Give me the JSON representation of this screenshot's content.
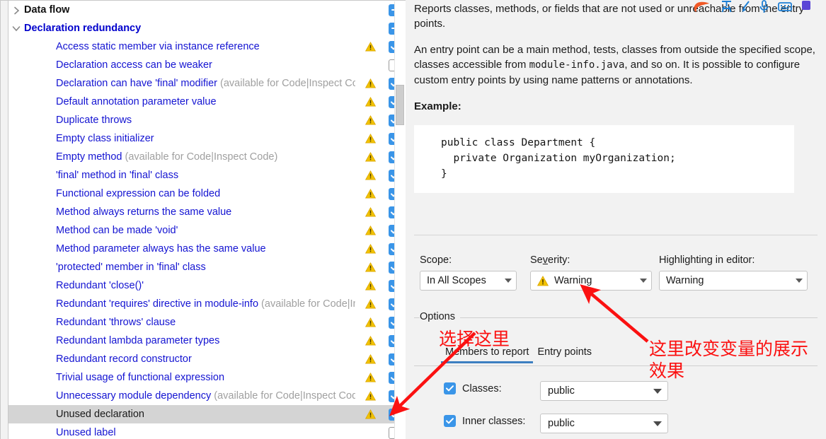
{
  "tree": {
    "items": [
      {
        "label": "Data flow",
        "kind": "group",
        "twisty": "chevron-right-icon",
        "color": "black",
        "check": "partial",
        "warn": false,
        "avail": ""
      },
      {
        "label": "Declaration redundancy",
        "kind": "group",
        "twisty": "chevron-down-icon",
        "color": "blue",
        "check": "partial",
        "warn": false,
        "avail": ""
      },
      {
        "label": "Access static member via instance reference",
        "kind": "leaf",
        "check": "on",
        "warn": true,
        "avail": ""
      },
      {
        "label": "Declaration access can be weaker",
        "kind": "leaf",
        "check": "off",
        "warn": false,
        "avail": ""
      },
      {
        "label": "Declaration can have 'final' modifier",
        "kind": "leaf",
        "check": "on",
        "warn": true,
        "avail": " (available for Code|Inspect Code)"
      },
      {
        "label": "Default annotation parameter value",
        "kind": "leaf",
        "check": "on",
        "warn": true,
        "avail": ""
      },
      {
        "label": "Duplicate throws",
        "kind": "leaf",
        "check": "on",
        "warn": true,
        "avail": ""
      },
      {
        "label": "Empty class initializer",
        "kind": "leaf",
        "check": "on",
        "warn": true,
        "avail": ""
      },
      {
        "label": "Empty method",
        "kind": "leaf",
        "check": "on",
        "warn": true,
        "avail": " (available for Code|Inspect Code)"
      },
      {
        "label": "'final' method in 'final' class",
        "kind": "leaf",
        "check": "on",
        "warn": true,
        "avail": ""
      },
      {
        "label": "Functional expression can be folded",
        "kind": "leaf",
        "check": "on",
        "warn": true,
        "avail": ""
      },
      {
        "label": "Method always returns the same value",
        "kind": "leaf",
        "check": "on",
        "warn": true,
        "avail": ""
      },
      {
        "label": "Method can be made 'void'",
        "kind": "leaf",
        "check": "on",
        "warn": true,
        "avail": ""
      },
      {
        "label": "Method parameter always has the same value",
        "kind": "leaf",
        "check": "on",
        "warn": true,
        "avail": ""
      },
      {
        "label": "'protected' member in 'final' class",
        "kind": "leaf",
        "check": "on",
        "warn": true,
        "avail": ""
      },
      {
        "label": "Redundant 'close()'",
        "kind": "leaf",
        "check": "on",
        "warn": true,
        "avail": ""
      },
      {
        "label": "Redundant 'requires' directive in module-info",
        "kind": "leaf",
        "check": "on",
        "warn": true,
        "avail": " (available for Code|Inspect Code)"
      },
      {
        "label": "Redundant 'throws' clause",
        "kind": "leaf",
        "check": "on",
        "warn": true,
        "avail": ""
      },
      {
        "label": "Redundant lambda parameter types",
        "kind": "leaf",
        "check": "on",
        "warn": true,
        "avail": ""
      },
      {
        "label": "Redundant record constructor",
        "kind": "leaf",
        "check": "on",
        "warn": true,
        "avail": ""
      },
      {
        "label": "Trivial usage of functional expression",
        "kind": "leaf",
        "check": "on",
        "warn": true,
        "avail": ""
      },
      {
        "label": "Unnecessary module dependency",
        "kind": "leaf",
        "check": "on",
        "warn": true,
        "avail": " (available for Code|Inspect Code)"
      },
      {
        "label": "Unused declaration",
        "kind": "leaf",
        "check": "on",
        "warn": true,
        "avail": "",
        "selected": true
      },
      {
        "label": "Unused label",
        "kind": "leaf",
        "check": "off",
        "warn": false,
        "avail": ""
      }
    ]
  },
  "description": {
    "para1": "Reports classes, methods, or fields that are not used or unreachable from the entry points.",
    "para2_a": "An entry point can be a main method, tests, classes from outside the specified scope, classes accessible from ",
    "para2_code": "module-info.java",
    "para2_b": ", and so on. It is possible to configure custom entry points by using name patterns or annotations.",
    "example_label": "Example:",
    "example_code": "public class Department {\n  private Organization myOrganization;\n}"
  },
  "controls": {
    "scope": {
      "caption": "Scope:",
      "value": "In All Scopes"
    },
    "severity": {
      "caption_pre": "Se",
      "caption_mnemonic": "v",
      "caption_post": "erity:",
      "value": "Warning",
      "icon": "warning-triangle-icon"
    },
    "highlighting": {
      "caption": "Highlighting in editor:",
      "value": "Warning"
    }
  },
  "options": {
    "legend": "Options",
    "tabs": [
      {
        "label": "Members to report",
        "active": true
      },
      {
        "label": "Entry points",
        "active": false
      }
    ],
    "rows": [
      {
        "label": "Classes:",
        "checked": true,
        "value": "public"
      },
      {
        "label": "Inner classes:",
        "checked": true,
        "value": "public"
      }
    ]
  },
  "annotations": {
    "note1": "选择这里",
    "note2": "这里改变变量的展示\n效果",
    "color": "#fb1111"
  },
  "colors": {
    "accent_blue": "#3a95e8",
    "tab_underline": "#3d7fc1",
    "link_blue": "#1414d2",
    "warning_yellow": "#f2c200",
    "selection_gray": "#d4d4d4"
  }
}
